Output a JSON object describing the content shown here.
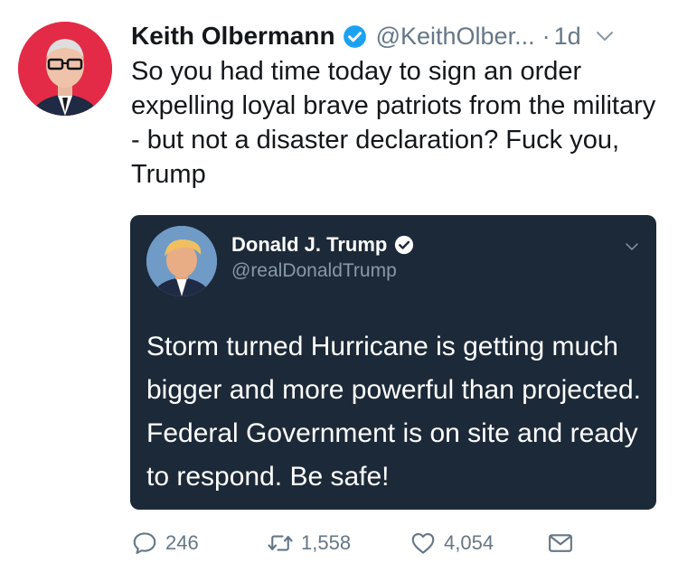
{
  "tweet": {
    "author_name": "Keith Olbermann",
    "handle": "@KeithOlber...",
    "separator": "·",
    "time": "1d",
    "text": "So you had time today to sign an order expelling loyal brave patriots from the military - but not a disaster declaration? Fuck you, Trump"
  },
  "quoted": {
    "author_name": "Donald J. Trump",
    "handle": "@realDonaldTrump",
    "text": "Storm turned Hurricane is getting much bigger and more powerful than projected. Federal Government is on site and ready to respond. Be safe!"
  },
  "actions": {
    "replies": "246",
    "retweets": "1,558",
    "likes": "4,054"
  },
  "icons": {
    "verified": "verified-badge-icon",
    "chevron": "chevron-down-icon",
    "reply": "reply-icon",
    "retweet": "retweet-icon",
    "like": "heart-icon",
    "dm": "envelope-icon"
  },
  "colors": {
    "verified_blue": "#1da1f2",
    "quote_bg": "#1c2938",
    "muted": "#657786"
  }
}
